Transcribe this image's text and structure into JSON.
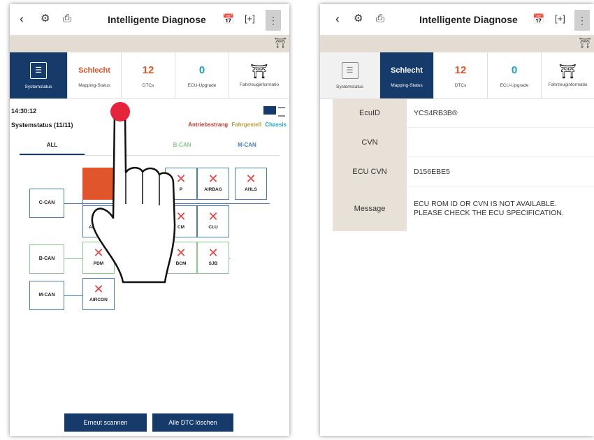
{
  "left": {
    "title": "Intelligente Diagnose",
    "tabs": [
      {
        "big": "",
        "small": "Systemstatus"
      },
      {
        "big": "Schlecht",
        "small": "Mapping-Status"
      },
      {
        "big": "12",
        "small": "DTCs"
      },
      {
        "big": "0",
        "small": "ECU-Upgrade"
      },
      {
        "big": "",
        "small": "Fahrzeuginformatio"
      }
    ],
    "time": "14:30:12",
    "system_status": "Systemstatus (11/11)",
    "legend": {
      "powertrain": "Antriebsstrang",
      "chassis_frame": "Fahrgestell",
      "chassis": "Chassis"
    },
    "bus_tabs": [
      "ALL",
      "C",
      "B-CAN",
      "M-CAN"
    ],
    "buses": {
      "c": "C-CAN",
      "b": "B-CAN",
      "m": "M-CAN"
    },
    "ecus": {
      "p": "P",
      "airbag": "AIRBAG",
      "ahls": "AHLS",
      "air": "AIR",
      "cm": "CM",
      "clu": "CLU",
      "pdm": "PDM",
      "bcm": "BCM",
      "sjb": "SJB",
      "aircon": "AIRCON"
    },
    "buttons": {
      "rescan": "Erneut scannen",
      "clear": "Alle DTC löschen"
    }
  },
  "right": {
    "title": "Intelligente Diagnose",
    "tabs": [
      {
        "big": "",
        "small": "Systemstatus"
      },
      {
        "big": "Schlecht",
        "small": "Mapping-Status"
      },
      {
        "big": "12",
        "small": "DTCs"
      },
      {
        "big": "0",
        "small": "ECU-Upgrade"
      },
      {
        "big": "",
        "small": "Fahrzeuginformatio"
      }
    ],
    "rows": [
      {
        "key": "EcuID",
        "value": "YCS4RB3B®"
      },
      {
        "key": "CVN",
        "value": ""
      },
      {
        "key": "ECU CVN",
        "value": "D156EBE5"
      },
      {
        "key": "Message",
        "value": "ECU ROM ID OR CVN IS NOT AVAILABLE.\nPLEASE CHECK THE ECU SPECIFICATION."
      }
    ]
  },
  "colors": {
    "navy": "#163a6a",
    "orange": "#e0552b",
    "teal": "#1a9fc0",
    "green": "#8cc78a",
    "blue_border": "#4a7fb5",
    "red_x": "#e04545",
    "pointer": "#e5233a"
  }
}
